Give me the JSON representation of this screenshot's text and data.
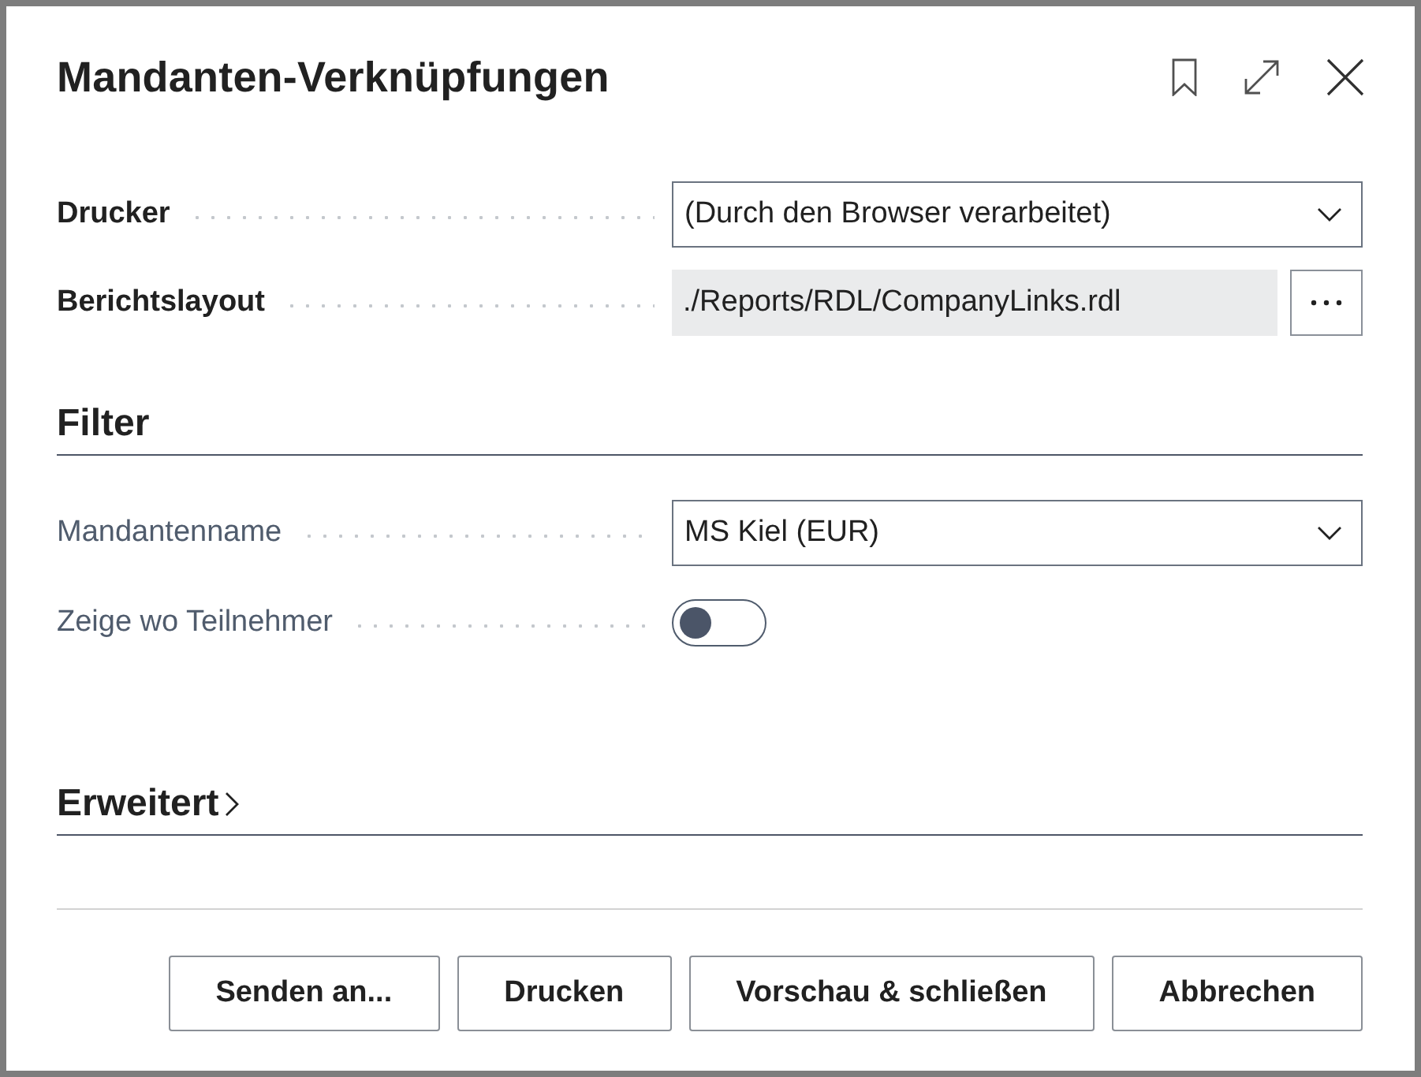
{
  "dialog": {
    "title": "Mandanten-Verknüpfungen"
  },
  "options": {
    "fields": [
      {
        "kind": "select",
        "label": "Drucker",
        "value": "(Durch den Browser verarbeitet)"
      },
      {
        "kind": "lookup",
        "label": "Berichtslayout",
        "value": "./Reports/RDL/CompanyLinks.rdl"
      }
    ]
  },
  "filter": {
    "title": "Filter",
    "fields": [
      {
        "kind": "select",
        "label": "Mandantenname",
        "value": "MS Kiel (EUR)"
      },
      {
        "kind": "toggle",
        "label": "Zeige wo Teilnehmer",
        "on": false
      }
    ]
  },
  "advanced": {
    "title": "Erweitert",
    "expanded": false
  },
  "buttons": [
    "Senden an...",
    "Drucken",
    "Vorschau & schließen",
    "Abbrechen"
  ]
}
